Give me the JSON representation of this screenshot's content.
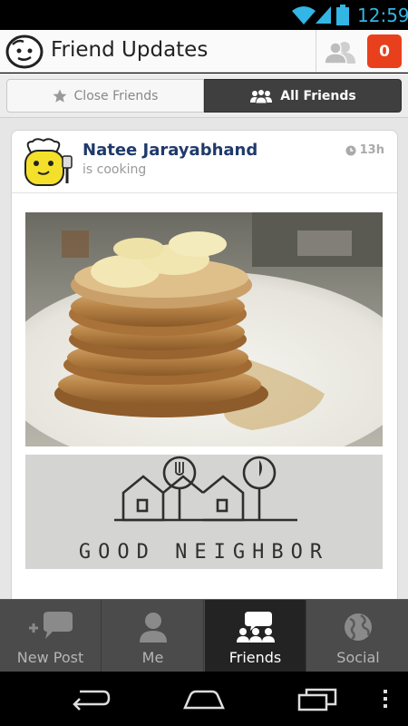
{
  "status_bar": {
    "time": "12:59"
  },
  "app_bar": {
    "title": "Friend Updates",
    "notification_count": "0"
  },
  "tabs": [
    {
      "label": "Close Friends",
      "icon": "star-icon",
      "active": false
    },
    {
      "label": "All Friends",
      "icon": "people-icon",
      "active": true
    }
  ],
  "post": {
    "author": "Natee Jarayabhand",
    "activity": "is cooking",
    "time": "13h",
    "logo_text": "GOOD NEIGHBOR"
  },
  "bottom_nav": [
    {
      "label": "New Post",
      "icon": "new-post-icon",
      "active": false
    },
    {
      "label": "Me",
      "icon": "person-icon",
      "active": false
    },
    {
      "label": "Friends",
      "icon": "friends-icon",
      "active": true
    },
    {
      "label": "Social",
      "icon": "globe-icon",
      "active": false
    }
  ],
  "colors": {
    "accent_blue": "#33b5e5",
    "notification_red": "#e8401c",
    "author_blue": "#1f3a6b",
    "nav_bg": "#4b4b4b",
    "nav_active_bg": "#232323"
  }
}
